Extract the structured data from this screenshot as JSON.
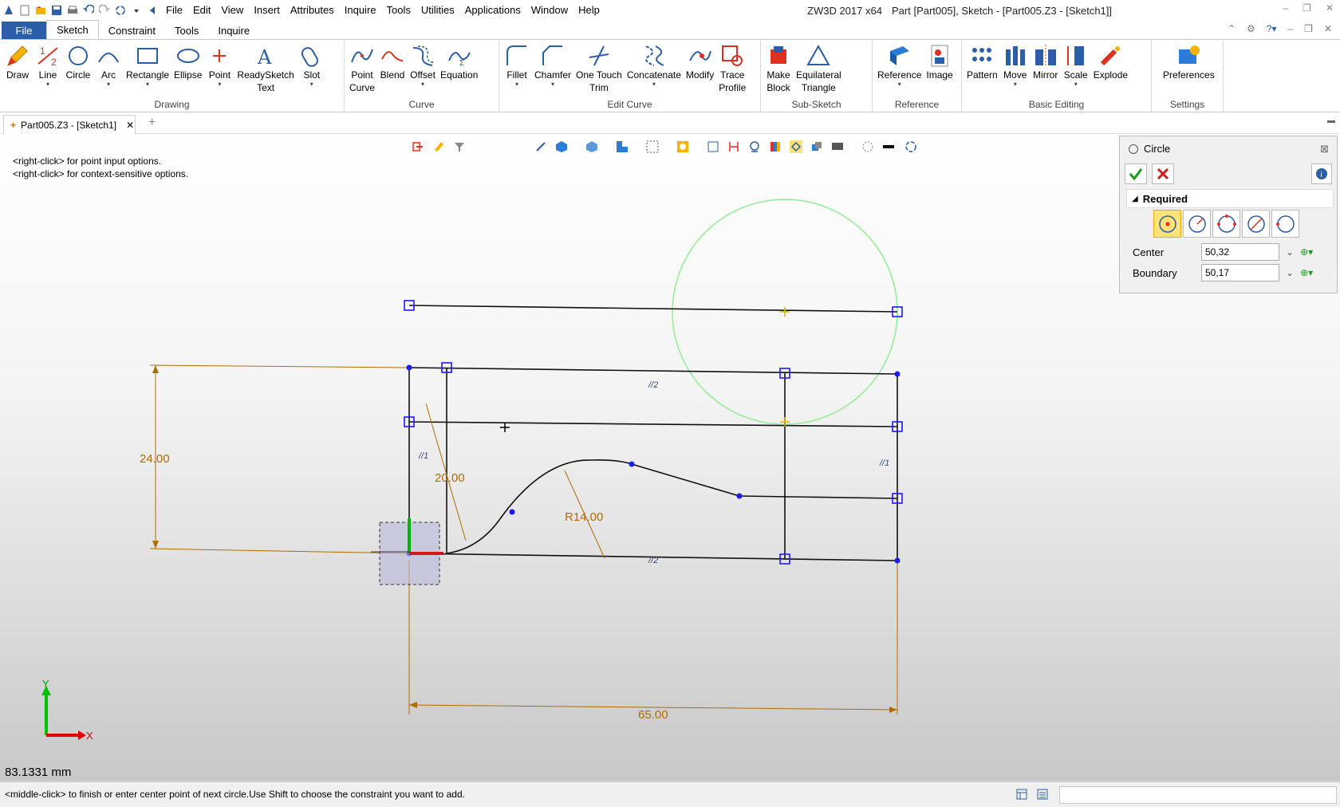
{
  "app_title": "ZW3D 2017  x64",
  "doc_title": "Part [Part005], Sketch - [Part005.Z3 - [Sketch1]]",
  "menu": [
    "File",
    "Edit",
    "View",
    "Insert",
    "Attributes",
    "Inquire",
    "Tools",
    "Utilities",
    "Applications",
    "Window",
    "Help"
  ],
  "ribbon_tabs": {
    "file": "File",
    "sketch": "Sketch",
    "constraint": "Constraint",
    "tools": "Tools",
    "inquire": "Inquire"
  },
  "groups": {
    "drawing": "Drawing",
    "curve": "Curve",
    "edit_curve": "Edit Curve",
    "sub_sketch": "Sub-Sketch",
    "reference": "Reference",
    "basic_editing": "Basic Editing",
    "settings": "Settings"
  },
  "buttons": {
    "draw": "Draw",
    "line": "Line",
    "circle": "Circle",
    "arc": "Arc",
    "rectangle": "Rectangle",
    "ellipse": "Ellipse",
    "point": "Point",
    "readysketch": "ReadySketch",
    "readysketch2": "Text",
    "slot": "Slot",
    "point_curve": "Point",
    "point_curve2": "Curve",
    "blend": "Blend",
    "offset": "Offset",
    "equation": "Equation",
    "fillet": "Fillet",
    "chamfer": "Chamfer",
    "one_touch": "One Touch",
    "one_touch2": "Trim",
    "concatenate": "Concatenate",
    "modify": "Modify",
    "trace": "Trace",
    "trace2": "Profile",
    "make_block": "Make",
    "make_block2": "Block",
    "equilateral": "Equilateral",
    "equilateral2": "Triangle",
    "reference": "Reference",
    "image": "Image",
    "pattern": "Pattern",
    "move": "Move",
    "mirror": "Mirror",
    "scale": "Scale",
    "explode": "Explode",
    "preferences": "Preferences"
  },
  "doc_tab": "Part005.Z3 - [Sketch1]",
  "hints": [
    "<right-click> for point input options.",
    "<right-click> for context-sensitive options."
  ],
  "dimensions": {
    "height": "24.00",
    "diameter": "20.00",
    "radius": "R14.00",
    "width": "65.00"
  },
  "constraint_marks": {
    "parallel1": "//1",
    "parallel2": "//2"
  },
  "axis": {
    "x": "X",
    "y": "Y"
  },
  "distance": "83.1331 mm",
  "panel": {
    "title": "Circle",
    "section": "Required",
    "center_label": "Center",
    "center_value": "50,32",
    "boundary_label": "Boundary",
    "boundary_value": "50,17"
  },
  "status": "<middle-click> to finish or enter center point of next circle.Use Shift to choose the constraint you want to add.",
  "colors": {
    "accent": "#2b5ea8",
    "dimension": "#b06d00",
    "handle": "#1a1aff",
    "preview_circle": "#90ee90",
    "ok": "#1a9a1a",
    "cancel": "#d01a1a"
  }
}
